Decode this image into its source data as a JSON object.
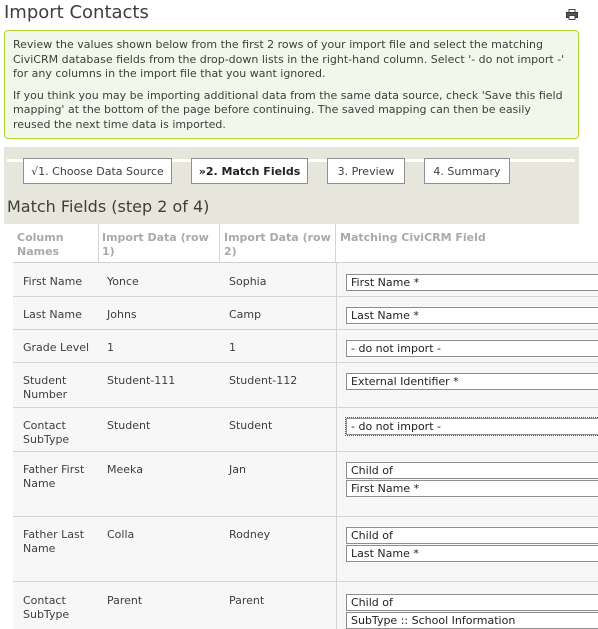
{
  "page": {
    "title": "Import Contacts",
    "print_icon": "print-icon"
  },
  "help": {
    "paragraph1": "Review the values shown below from the first 2 rows of your import file and select the matching CiviCRM database fields from the drop-down lists in the right-hand column. Select '- do not import -' for any columns in the import file that you want ignored.",
    "paragraph2": "If you think you may be importing additional data from the same data source, check 'Save this field mapping' at the bottom of the page before continuing. The saved mapping can then be easily reused the next time data is imported."
  },
  "wizard": {
    "steps": [
      {
        "label": "√1. Choose Data Source",
        "active": false
      },
      {
        "label": "»2. Match Fields",
        "active": true
      },
      {
        "label": "3. Preview",
        "active": false
      },
      {
        "label": "4. Summary",
        "active": false
      }
    ]
  },
  "section": {
    "title": "Match Fields (step 2 of 4)"
  },
  "table": {
    "headers": {
      "column_names": "Column Names",
      "import_row1": "Import Data (row 1)",
      "import_row2": "Import Data (row 2)",
      "matching_field": "Matching CiviCRM Field"
    },
    "rows": [
      {
        "name": "First Name",
        "row1": "Yonce",
        "row2": "Sophia",
        "fields": [
          "First Name *"
        ]
      },
      {
        "name": "Last Name",
        "row1": "Johns",
        "row2": "Camp",
        "fields": [
          "Last Name *"
        ]
      },
      {
        "name": "Grade Level",
        "row1": "1",
        "row2": "1",
        "fields": [
          "- do not import -"
        ]
      },
      {
        "name": "Student Number",
        "row1": "Student-111",
        "row2": "Student-112",
        "fields": [
          "External Identifier *"
        ]
      },
      {
        "name": "Contact SubType",
        "row1": "Student",
        "row2": "Student",
        "fields": [
          "- do not import -"
        ]
      },
      {
        "name": "Father First Name",
        "row1": "Meeka",
        "row2": "Jan",
        "fields": [
          "Child of",
          "First Name *"
        ]
      },
      {
        "name": "Father Last Name",
        "row1": "Colla",
        "row2": "Rodney",
        "fields": [
          "Child of",
          "Last Name *"
        ]
      },
      {
        "name": "Contact SubType",
        "row1": "Parent",
        "row2": "Parent",
        "fields": [
          "Child of",
          "SubType :: School Information"
        ]
      }
    ]
  }
}
